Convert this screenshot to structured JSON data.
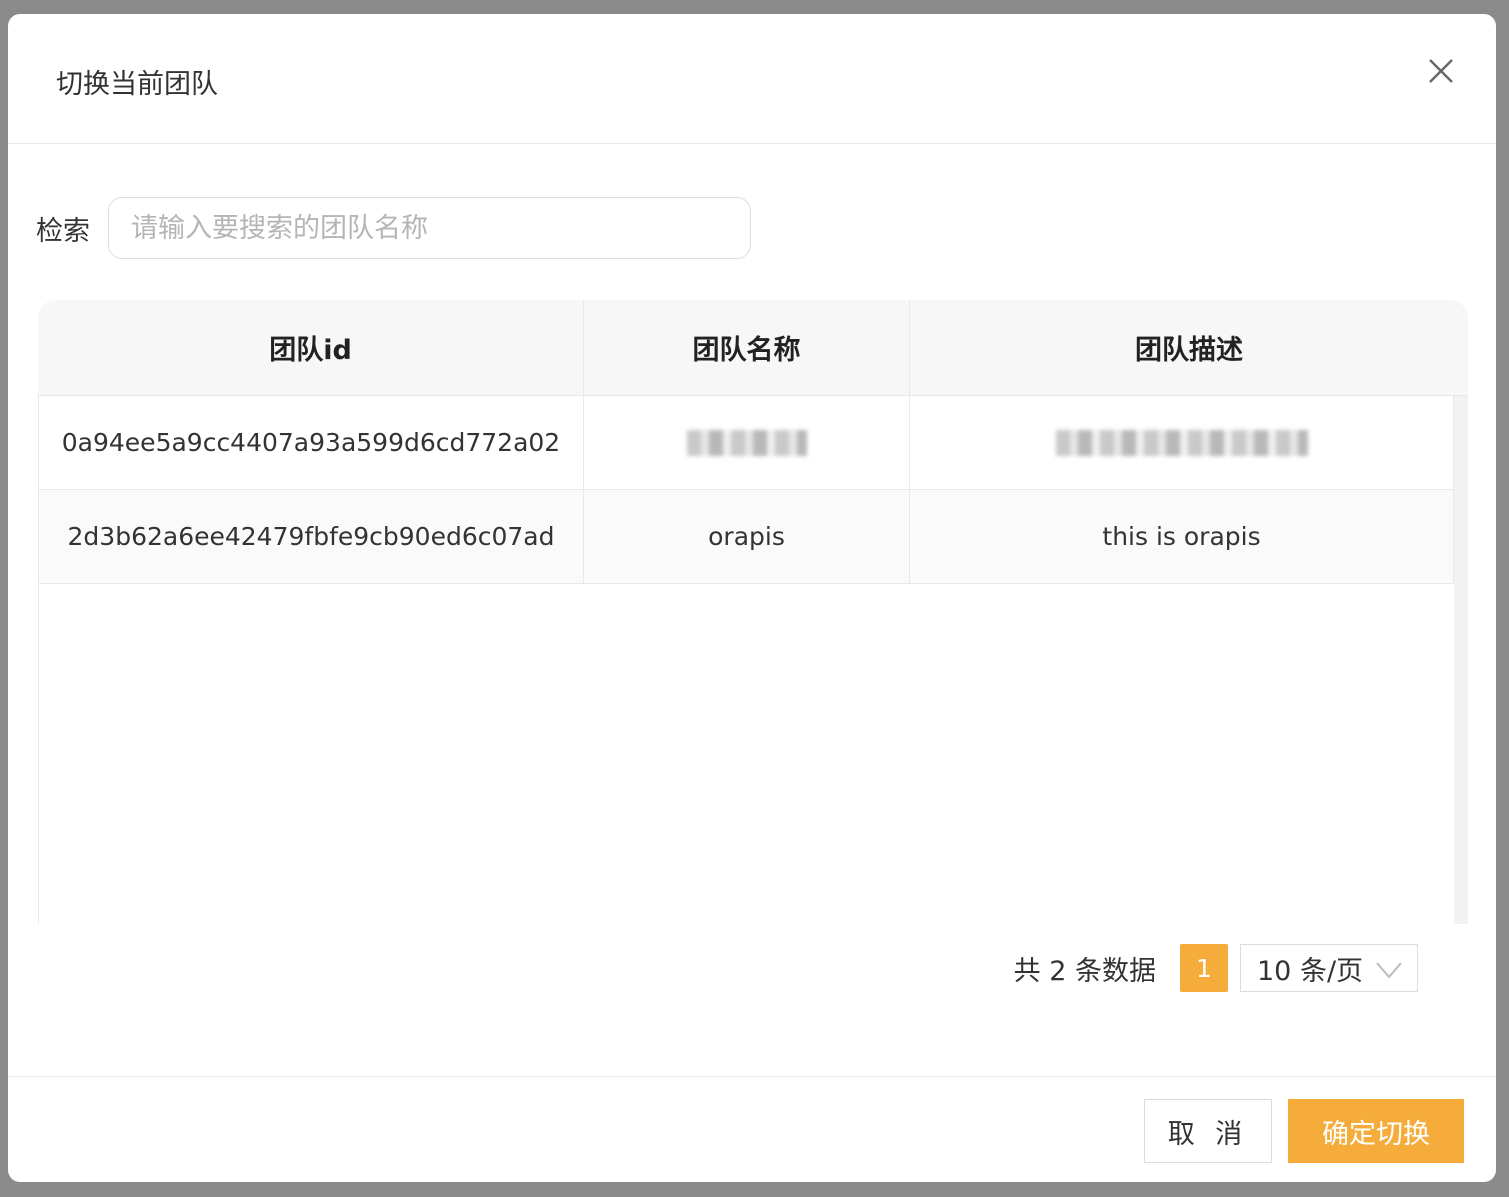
{
  "modal": {
    "title": "切换当前团队"
  },
  "search": {
    "label": "检索",
    "placeholder": "请输入要搜索的团队名称",
    "value": ""
  },
  "table": {
    "columns": [
      "团队id",
      "团队名称",
      "团队描述"
    ],
    "rows": [
      {
        "id": "0a94ee5a9cc4407a93a599d6cd772a02",
        "name": "",
        "description": ""
      },
      {
        "id": "2d3b62a6ee42479fbfe9cb90ed6c07ad",
        "name": "orapis",
        "description": "this is orapis"
      }
    ]
  },
  "pagination": {
    "total_text": "共 2 条数据",
    "current_page": "1",
    "page_size": "10 条/页"
  },
  "footer": {
    "cancel_label": "取 消",
    "confirm_label": "确定切换"
  },
  "colors": {
    "accent": "#f6ac3b",
    "header_bg": "#f7f7f7"
  }
}
